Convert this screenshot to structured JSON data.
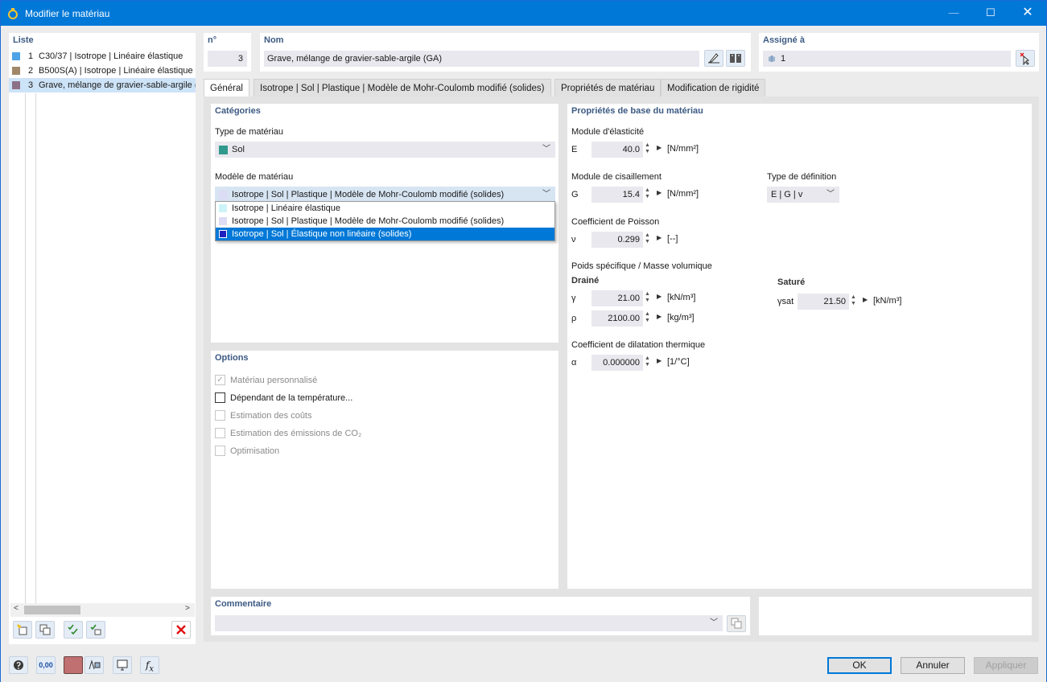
{
  "window": {
    "title": "Modifier le matériau"
  },
  "list": {
    "header": "Liste",
    "items": [
      {
        "num": "1",
        "text": "C30/37 | Isotrope | Linéaire élastique",
        "color": "#4da3e6"
      },
      {
        "num": "2",
        "text": "B500S(A) | Isotrope | Linéaire élastique",
        "color": "#a08868"
      },
      {
        "num": "3",
        "text": "Grave, mélange de gravier-sable-argile (GA)",
        "color": "#8c7088"
      }
    ]
  },
  "number": {
    "header": "n°",
    "value": "3"
  },
  "name": {
    "header": "Nom",
    "value": "Grave, mélange de gravier-sable-argile (GA)"
  },
  "assigned": {
    "header": "Assigné à",
    "value": "1"
  },
  "tabs": [
    {
      "label": "Général"
    },
    {
      "label": "Isotrope | Sol | Plastique | Modèle de Mohr-Coulomb modifié (solides)"
    },
    {
      "label": "Propriétés de matériau"
    },
    {
      "label": "Modification de rigidité"
    }
  ],
  "categories": {
    "header": "Catégories",
    "material_type_label": "Type de matériau",
    "material_type_value": "Sol",
    "material_type_color": "#2f9a8c",
    "model_label": "Modèle de matériau",
    "model_value": "Isotrope | Sol | Plastique | Modèle de Mohr-Coulomb modifié (solides)",
    "model_options": [
      {
        "label": "Isotrope | Linéaire élastique",
        "color": "#ccf4f8"
      },
      {
        "label": "Isotrope | Sol | Plastique | Modèle de Mohr-Coulomb modifié (solides)",
        "color": "#dcdcf6"
      },
      {
        "label": "Isotrope | Sol | Élastique non linéaire (solides)",
        "color": "#2020c0"
      }
    ]
  },
  "options": {
    "header": "Options",
    "items": [
      {
        "label": "Matériau personnalisé",
        "checked": true,
        "enabled": false
      },
      {
        "label": "Dépendant de la température...",
        "checked": false,
        "enabled": true
      },
      {
        "label": "Estimation des coûts",
        "checked": false,
        "enabled": false
      },
      {
        "label": "Estimation des émissions de CO₂",
        "checked": false,
        "enabled": false
      },
      {
        "label": "Optimisation",
        "checked": false,
        "enabled": false
      }
    ]
  },
  "props": {
    "header": "Propriétés de base du matériau",
    "elastic_label": "Module d'élasticité",
    "E_sym": "E",
    "E_val": "40.0",
    "E_unit": "[N/mm²]",
    "shear_label": "Module de cisaillement",
    "G_sym": "G",
    "G_val": "15.4",
    "G_unit": "[N/mm²]",
    "def_type_label": "Type de définition",
    "def_type_value": "E | G | v",
    "poisson_label": "Coefficient de Poisson",
    "v_sym": "ν",
    "v_val": "0.299",
    "v_unit": "[--]",
    "weight_label": "Poids spécifique / Masse volumique",
    "drained_label": "Drainé",
    "gamma_sym": "γ",
    "gamma_val": "21.00",
    "gamma_unit": "[kN/m³]",
    "rho_sym": "ρ",
    "rho_val": "2100.00",
    "rho_unit": "[kg/m³]",
    "saturated_label": "Saturé",
    "gsat_sym": "γsat",
    "gsat_val": "21.50",
    "gsat_unit": "[kN/m³]",
    "thermal_label": "Coefficient de dilatation thermique",
    "alpha_sym": "α",
    "alpha_val": "0.000000",
    "alpha_unit": "[1/°C]"
  },
  "comment": {
    "header": "Commentaire",
    "value": ""
  },
  "footer": {
    "ok": "OK",
    "cancel": "Annuler",
    "apply": "Appliquer",
    "units_icon_text": "0,00"
  }
}
